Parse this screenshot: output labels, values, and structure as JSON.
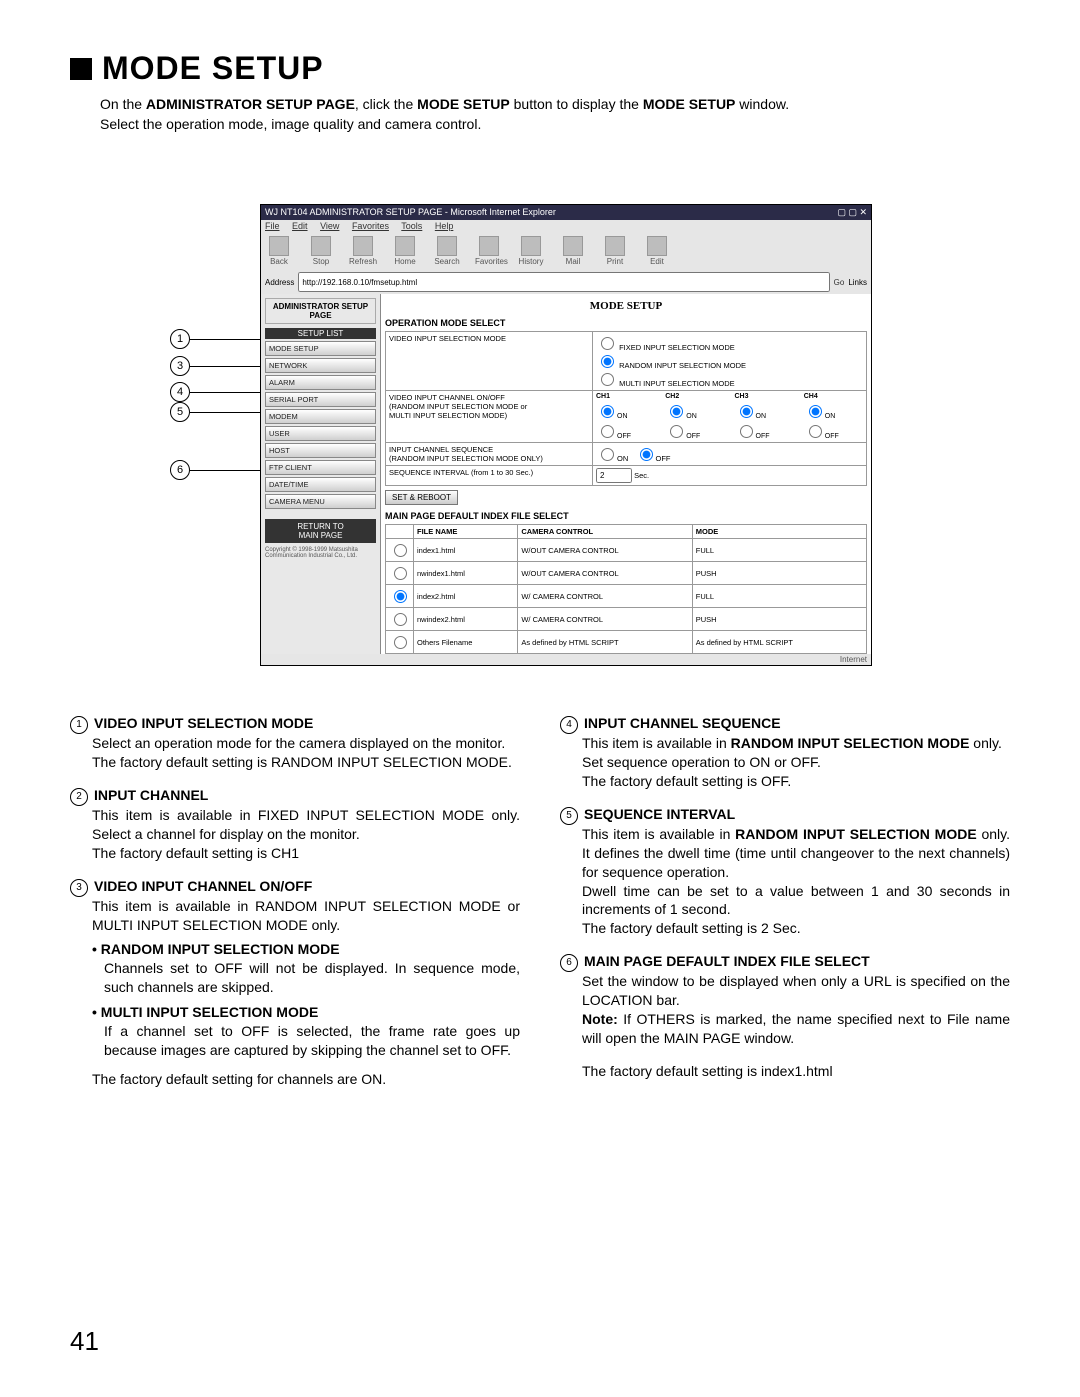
{
  "title": "MODE SETUP",
  "intro_parts": {
    "p1a": "On the ",
    "p1b": "ADMINISTRATOR SETUP PAGE",
    "p1c": ", click the ",
    "p1d": "MODE SETUP",
    "p1e": " button to display the ",
    "p1f": "MODE SETUP",
    "p1g": " window.",
    "p2": "Select the operation mode, image quality and camera control."
  },
  "callouts": {
    "c1": "1",
    "c3": "3",
    "c4": "4",
    "c5": "5",
    "c6": "6"
  },
  "browser": {
    "title": "WJ NT104 ADMINISTRATOR SETUP PAGE - Microsoft Internet Explorer",
    "menus": {
      "file": "File",
      "edit": "Edit",
      "view": "View",
      "fav": "Favorites",
      "tools": "Tools",
      "help": "Help"
    },
    "toolbar": {
      "back": "Back",
      "stop": "Stop",
      "refresh": "Refresh",
      "home": "Home",
      "search": "Search",
      "favorites": "Favorites",
      "history": "History",
      "mail": "Mail",
      "print": "Print",
      "edit": "Edit"
    },
    "address_label": "Address",
    "address_value": "http://192.168.0.10/fmsetup.html",
    "go": "Go",
    "links": "Links",
    "status_right": "Internet"
  },
  "sidebar": {
    "header": "ADMINISTRATOR SETUP PAGE",
    "list_header": "SETUP LIST",
    "items": [
      {
        "label": "MODE SETUP"
      },
      {
        "label": "NETWORK"
      },
      {
        "label": "ALARM"
      },
      {
        "label": "SERIAL PORT"
      },
      {
        "label": "MODEM"
      },
      {
        "label": "USER"
      },
      {
        "label": "HOST"
      },
      {
        "label": "FTP CLIENT"
      },
      {
        "label": "DATE/TIME"
      },
      {
        "label": "CAMERA MENU"
      }
    ],
    "return1": "RETURN TO",
    "return2": "MAIN PAGE",
    "copyright": "Copyright © 1998-1999 Matsushita Communication Industrial Co., Ltd."
  },
  "content": {
    "page_title": "MODE SETUP",
    "s1": "OPERATION MODE SELECT",
    "row1_label": "VIDEO INPUT SELECTION MODE",
    "row1_opts": {
      "a": "FIXED INPUT SELECTION MODE",
      "b": "RANDOM INPUT SELECTION MODE",
      "c": "MULTI INPUT SELECTION MODE"
    },
    "row2_label1": "VIDEO INPUT CHANNEL ON/OFF",
    "row2_label2": "(RANDOM INPUT SELECTION MODE or",
    "row2_label3": "MULTI INPUT SELECTION MODE)",
    "ch1": "CH1",
    "ch2": "CH2",
    "ch3": "CH3",
    "ch4": "CH4",
    "on": "ON",
    "off": "OFF",
    "row3_label1": "INPUT CHANNEL SEQUENCE",
    "row3_label2": "(RANDOM INPUT SELECTION MODE ONLY)",
    "row4_label": "SEQUENCE INTERVAL (from 1 to 30 Sec.)",
    "row4_val": "2",
    "row4_unit": "Sec.",
    "set_btn": "SET & REBOOT",
    "s2": "MAIN PAGE DEFAULT INDEX FILE SELECT",
    "files_h1": "FILE NAME",
    "files_h2": "CAMERA CONTROL",
    "files_h3": "MODE",
    "files": [
      {
        "name": "index1.html",
        "cc": "W/OUT CAMERA CONTROL",
        "mode": "FULL",
        "sel": false
      },
      {
        "name": "nwindex1.html",
        "cc": "W/OUT CAMERA CONTROL",
        "mode": "PUSH",
        "sel": false
      },
      {
        "name": "index2.html",
        "cc": "W/ CAMERA CONTROL",
        "mode": "FULL",
        "sel": true
      },
      {
        "name": "nwindex2.html",
        "cc": "W/ CAMERA CONTROL",
        "mode": "PUSH",
        "sel": false
      }
    ],
    "others_label": "Others  Filename",
    "others_cc": "As defined by HTML SCRIPT",
    "others_mode": "As defined by HTML SCRIPT"
  },
  "desc": {
    "i1": {
      "n": "1",
      "t": "VIDEO INPUT SELECTION MODE",
      "b1": "Select an operation mode for the camera displayed on the monitor.",
      "b2": "The factory default setting is RANDOM INPUT SELECTION MODE."
    },
    "i2": {
      "n": "2",
      "t": "INPUT CHANNEL",
      "b1": "This item is available in FIXED INPUT SELECTION MODE only. Select a channel for display on the monitor.",
      "b2": "The factory default setting is CH1"
    },
    "i3": {
      "n": "3",
      "t": "VIDEO INPUT CHANNEL ON/OFF",
      "b1": "This item is available in RANDOM INPUT SELECTION MODE or MULTI INPUT SELECTION MODE only.",
      "sub1_t": "RANDOM INPUT SELECTION MODE",
      "sub1_b": "Channels set to OFF will not be displayed. In sequence mode, such channels are skipped.",
      "sub2_t": "MULTI INPUT SELECTION MODE",
      "sub2_b": "If a channel set to OFF is selected, the frame rate goes up because images are captured by skipping the channel set to OFF.",
      "b2": "The factory default setting for channels are ON."
    },
    "i4": {
      "n": "4",
      "t": "INPUT CHANNEL SEQUENCE",
      "b1a": "This item is available in ",
      "b1b": "RANDOM INPUT SELECTION MODE",
      "b1c": " only.",
      "b2": "Set sequence operation to ON or OFF.",
      "b3": "The factory default setting is OFF."
    },
    "i5": {
      "n": "5",
      "t": "SEQUENCE INTERVAL",
      "b1a": "This item is available in ",
      "b1b": "RANDOM INPUT SELECTION MODE",
      "b1c": " only. It defines the dwell time (time until changeover to the next channels) for sequence operation.",
      "b2": "Dwell time can be set to a value between 1 and 30 seconds in increments of 1 second.",
      "b3": "The factory default setting is 2 Sec."
    },
    "i6": {
      "n": "6",
      "t": "MAIN PAGE DEFAULT INDEX FILE SELECT",
      "b1": "Set the window to be displayed when only a URL is specified on the LOCATION bar.",
      "note_l": "Note:",
      "note_b": " If OTHERS is marked, the name specified next to File name will open the MAIN PAGE window.",
      "b2": "The factory default setting is index1.html"
    }
  },
  "page_number": "41"
}
